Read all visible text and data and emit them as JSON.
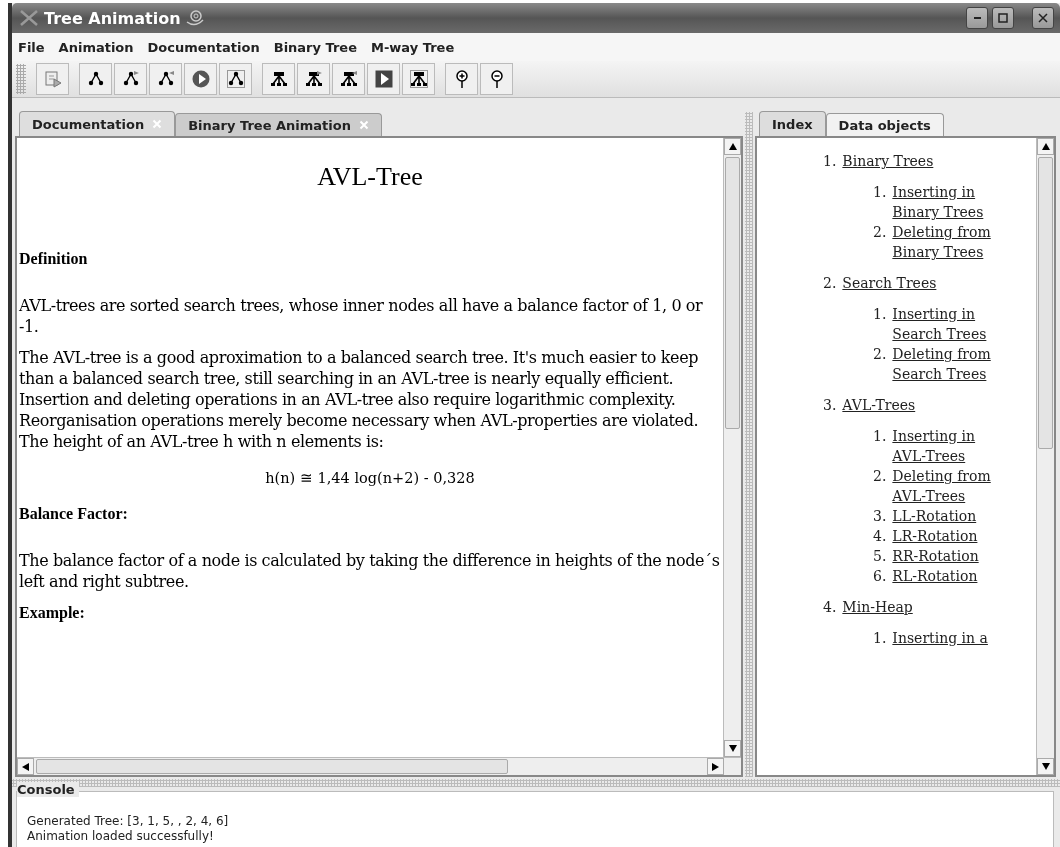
{
  "window": {
    "title": "Tree Animation"
  },
  "menu": [
    {
      "label": "File"
    },
    {
      "label": "Animation"
    },
    {
      "label": "Documentation"
    },
    {
      "label": "Binary Tree"
    },
    {
      "label": "M-way Tree"
    }
  ],
  "toolbar": [
    [
      {
        "kind": "import"
      }
    ],
    [
      {
        "kind": "tree"
      },
      {
        "kind": "tree-add"
      },
      {
        "kind": "tree-remove"
      },
      {
        "kind": "play-round"
      },
      {
        "kind": "tree-frame"
      }
    ],
    [
      {
        "kind": "mtree"
      },
      {
        "kind": "mtree-add"
      },
      {
        "kind": "mtree-remove"
      },
      {
        "kind": "play-square"
      },
      {
        "kind": "mtree-frame"
      }
    ],
    [
      {
        "kind": "zoom-in"
      },
      {
        "kind": "zoom-out"
      }
    ]
  ],
  "tabs": [
    {
      "label": "Documentation",
      "selected": true
    },
    {
      "label": "Binary Tree Animation",
      "selected": false
    }
  ],
  "document": {
    "title": "AVL-Tree",
    "blocks": [
      {
        "kind": "heading",
        "text": "Definition"
      },
      {
        "kind": "paragraph",
        "text": "AVL-trees are sorted search trees, whose inner nodes all have a balance factor of 1, 0 or -1."
      },
      {
        "kind": "paragraph",
        "text": "The AVL-tree is a good aproximation to a balanced search tree. It's much easier to keep than a balanced search tree, still searching in an AVL-tree is nearly equally efficient. Insertion and deleting operations in an AVL-tree also require logarithmic complexity. Reorganisation operations merely become necessary when AVL-properties are violated. The height of an AVL-tree h with n elements is:"
      },
      {
        "kind": "formula",
        "text": "h(n) ≅ 1,44 log(n+2) - 0,328"
      },
      {
        "kind": "heading",
        "text": "Balance Factor:"
      },
      {
        "kind": "paragraph",
        "text": "The balance factor of a node is calculated by taking the difference in heights of the node´s left and right subtree."
      },
      {
        "kind": "heading",
        "text": "Example:"
      }
    ]
  },
  "side_tabs": [
    {
      "label": "Index",
      "selected": true
    },
    {
      "label": "Data objects",
      "selected": false
    }
  ],
  "index": [
    {
      "number": "1.",
      "label": "Binary Trees",
      "children": [
        {
          "number": "1.",
          "label": "Inserting in Binary Trees"
        },
        {
          "number": "2.",
          "label": "Deleting from Binary Trees"
        }
      ]
    },
    {
      "number": "2.",
      "label": "Search Trees",
      "children": [
        {
          "number": "1.",
          "label": "Inserting in Search Trees"
        },
        {
          "number": "2.",
          "label": "Deleting from Search Trees"
        }
      ]
    },
    {
      "number": "3.",
      "label": "AVL-Trees",
      "children": [
        {
          "number": "1.",
          "label": "Inserting in AVL-Trees"
        },
        {
          "number": "2.",
          "label": "Deleting from AVL-Trees"
        },
        {
          "number": "3.",
          "label": "LL-Rotation"
        },
        {
          "number": "4.",
          "label": "LR-Rotation"
        },
        {
          "number": "5.",
          "label": "RR-Rotation"
        },
        {
          "number": "6.",
          "label": "RL-Rotation"
        }
      ]
    },
    {
      "number": "4.",
      "label": "Min-Heap",
      "children": [
        {
          "number": "1.",
          "label": "Inserting in a"
        }
      ]
    }
  ],
  "console": {
    "title": "Console",
    "lines": [
      "Generated Tree: [3, 1, 5, , 2, 4, 6]",
      "Animation loaded successfully!"
    ]
  }
}
